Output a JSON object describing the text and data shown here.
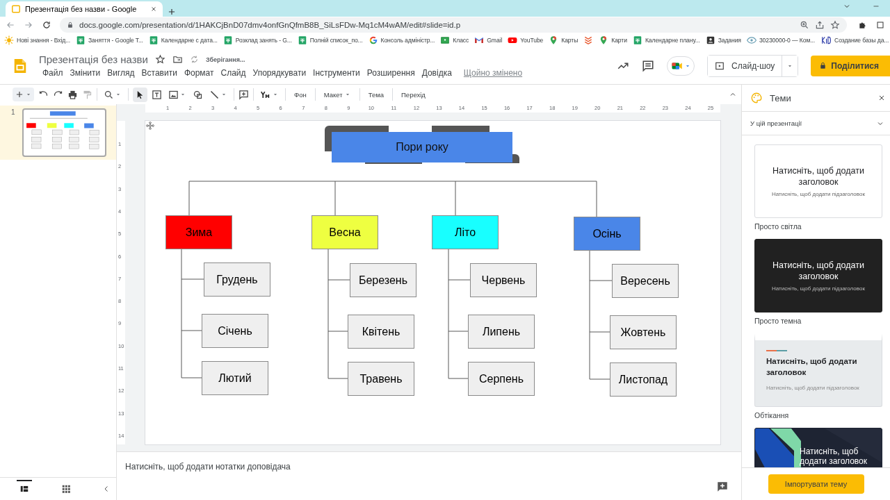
{
  "browser": {
    "tabs": [
      {
        "title": "Презентація без назви - Google",
        "selected": true
      }
    ],
    "url": "docs.google.com/presentation/d/1HAKCjBnD07dmv4onfGnQfmB8B_SiLsFDw-Mq1cM4wAM/edit#slide=id.p",
    "bookmarks": [
      {
        "kind": "sun",
        "label": "Нові знання - Вхід..."
      },
      {
        "kind": "sheets",
        "label": "Заняття - Google T..."
      },
      {
        "kind": "sheets",
        "label": "Календарне с дата..."
      },
      {
        "kind": "sheets",
        "label": "Розклад занять - G..."
      },
      {
        "kind": "sheets",
        "label": "Полній список_по..."
      },
      {
        "kind": "google",
        "label": "Консоль адміністр..."
      },
      {
        "kind": "classroom",
        "label": "Класс"
      },
      {
        "kind": "gmail",
        "label": "Gmail"
      },
      {
        "kind": "youtube",
        "label": "YouTube"
      },
      {
        "kind": "maps",
        "label": "Карты"
      },
      {
        "kind": "stack"
      },
      {
        "kind": "maps",
        "label": "Карти"
      },
      {
        "kind": "sheets",
        "label": "Календарне плану..."
      },
      {
        "kind": "assignment",
        "label": "Задания"
      },
      {
        "kind": "eye",
        "label": "30230000-0 — Ком..."
      },
      {
        "kind": "kid",
        "label": "Создание базы да..."
      }
    ]
  },
  "app": {
    "title": "Презентація без назви",
    "save_status": "Зберігання...",
    "menu": [
      "Файл",
      "Змінити",
      "Вигляд",
      "Вставити",
      "Формат",
      "Слайд",
      "Упорядкувати",
      "Інструменти",
      "Розширення",
      "Довідка"
    ],
    "last_edit": "Щойно змінено",
    "slideshow": "Слайд-шоу",
    "share": "Поділитися"
  },
  "toolbar": {
    "text_buttons": [
      {
        "label": "Фон",
        "dropdown": false
      },
      {
        "label": "Макет",
        "dropdown": true
      },
      {
        "label": "Тема",
        "dropdown": false
      },
      {
        "label": "Перехід",
        "dropdown": false
      }
    ]
  },
  "rulers": {
    "horizontal": [
      "1",
      "2",
      "3",
      "4",
      "5",
      "6",
      "7",
      "8",
      "9",
      "10",
      "11",
      "12",
      "13",
      "14",
      "15",
      "16",
      "17",
      "18",
      "19",
      "20",
      "21",
      "22",
      "23",
      "24",
      "25"
    ],
    "vertical": [
      "1",
      "2",
      "3",
      "4",
      "5",
      "6",
      "7",
      "8",
      "9",
      "10",
      "11",
      "12",
      "13",
      "14"
    ]
  },
  "filmstrip": {
    "slides": [
      {
        "number": "1",
        "selected": true
      }
    ]
  },
  "slide": {
    "title": "Пори року",
    "seasons": [
      {
        "label": "Зима",
        "color": "#ff0000",
        "months": [
          "Грудень",
          "Січень",
          "Лютий"
        ]
      },
      {
        "label": "Весна",
        "color": "#eeff41",
        "months": [
          "Березень",
          "Квітень",
          "Травень"
        ]
      },
      {
        "label": "Літо",
        "color": "#18ffff",
        "months": [
          "Червень",
          "Липень",
          "Серпень"
        ]
      },
      {
        "label": "Осінь",
        "color": "#4a86e8",
        "months": [
          "Вересень",
          "Жовтень",
          "Листопад"
        ]
      }
    ]
  },
  "notes": {
    "placeholder": "Натисніть, щоб додати нотатки доповідача"
  },
  "themes_panel": {
    "title": "Теми",
    "section": "У цій презентації",
    "themes": [
      {
        "kind": "light",
        "name": "Просто світла",
        "heading": "Натисніть, щоб додати заголовок",
        "subheading": "Натисніть, щоб додати підзаголовок"
      },
      {
        "kind": "dark",
        "name": "Просто темна",
        "heading": "Натисніть, щоб додати заголовок",
        "subheading": "Натисніть, щоб додати підзаголовок"
      },
      {
        "kind": "streamline",
        "name": "Обтікання",
        "heading": "Натисніть, щоб додати заголовок",
        "subheading": "Натисніть, щоб додати підзаголовок"
      },
      {
        "kind": "focus",
        "heading": "Натисніть, щоб додати заголовок"
      }
    ],
    "import_button": "Імпортувати тему"
  }
}
